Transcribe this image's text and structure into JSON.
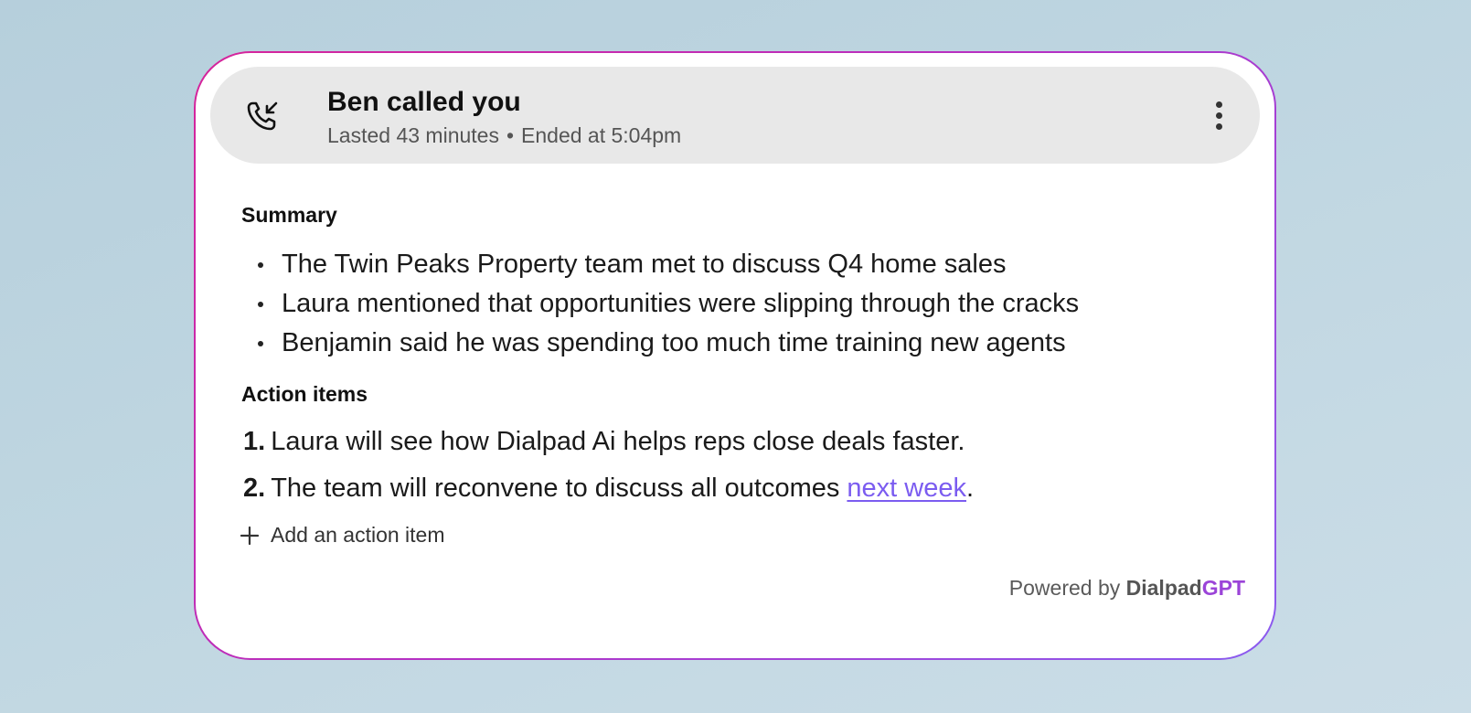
{
  "call": {
    "title": "Ben called you",
    "duration": "Lasted 43 minutes",
    "separator": "•",
    "ended": "Ended at 5:04pm",
    "icon": "incoming-call-icon",
    "menu_icon": "more-vertical-icon"
  },
  "summary": {
    "title": "Summary",
    "items": [
      "The Twin Peaks Property team met to discuss Q4 home sales",
      "Laura mentioned that opportunities were slipping through the cracks",
      "Benjamin said he was spending too much time training new agents"
    ]
  },
  "action_items": {
    "title": "Action items",
    "items": [
      {
        "number": "1.",
        "text": "Laura will see how Dialpad Ai helps reps close deals faster."
      },
      {
        "number": "2.",
        "text": "The team will reconvene to discuss all outcomes ",
        "link": "next week",
        "suffix": "."
      }
    ],
    "add_label": "Add an action item",
    "add_icon": "plus-icon"
  },
  "footer": {
    "prefix": "Powered by ",
    "brand_part1": "Dialpad",
    "brand_part2": "GPT"
  },
  "colors": {
    "link": "#7b5cf0",
    "brand_accent": "#9b44d8",
    "border_start": "#d6249a",
    "border_end": "#8a5cf0",
    "header_bg": "#e8e8e8"
  }
}
